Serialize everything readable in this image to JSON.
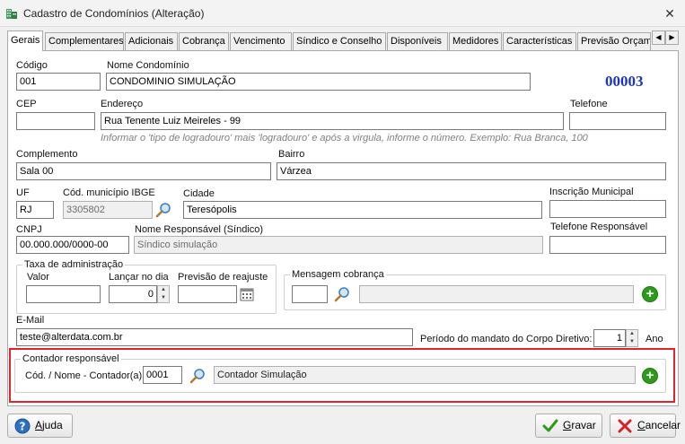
{
  "window": {
    "title": "Cadastro de Condomínios (Alteração)",
    "close": "✕"
  },
  "tabs": [
    {
      "label": "Gerais"
    },
    {
      "label": "Complementares"
    },
    {
      "label": "Adicionais"
    },
    {
      "label": "Cobrança"
    },
    {
      "label": "Vencimento"
    },
    {
      "label": "Síndico e Conselho"
    },
    {
      "label": "Disponíveis"
    },
    {
      "label": "Medidores"
    },
    {
      "label": "Características"
    },
    {
      "label": "Previsão Orçam"
    }
  ],
  "tab_arrows": {
    "left": "◀",
    "right": "▶"
  },
  "form": {
    "codigo": {
      "label": "Código",
      "value": "001"
    },
    "nome": {
      "label": "Nome Condomínio",
      "value": "CONDOMINIO SIMULAÇÃO"
    },
    "code_display": "00003",
    "cep": {
      "label": "CEP",
      "value": ""
    },
    "endereco": {
      "label": "Endereço",
      "value": "Rua Tenente Luiz Meireles - 99"
    },
    "telefone": {
      "label": "Telefone",
      "value": ""
    },
    "hint": "Informar o 'tipo de logradouro' mais 'logradouro' e após a virgula, informe o número. Exemplo: Rua Branca, 100",
    "complemento": {
      "label": "Complemento",
      "value": "Sala 00"
    },
    "bairro": {
      "label": "Bairro",
      "value": "Várzea"
    },
    "uf": {
      "label": "UF",
      "value": "RJ"
    },
    "ibge": {
      "label": "Cód. município IBGE",
      "value": "3305802"
    },
    "cidade": {
      "label": "Cidade",
      "value": "Teresópolis"
    },
    "inscricao": {
      "label": "Inscrição Municipal",
      "value": ""
    },
    "cnpj": {
      "label": "CNPJ",
      "value": "00.000.000/0000-00"
    },
    "responsavel": {
      "label": "Nome Responsável (Síndico)",
      "value": "Síndico simulação"
    },
    "tel_responsavel": {
      "label": "Telefone Responsável",
      "value": ""
    },
    "taxa": {
      "title": "Taxa de administração",
      "valor": {
        "label": "Valor",
        "value": ""
      },
      "lancar": {
        "label": "Lançar no dia",
        "value": "0"
      },
      "previsao": {
        "label": "Previsão de reajuste",
        "value": ""
      }
    },
    "mensagem": {
      "title": "Mensagem cobrança",
      "code": "",
      "text": ""
    },
    "email": {
      "label": "E-Mail",
      "value": "teste@alterdata.com.br"
    },
    "mandato": {
      "label": "Período do mandato do Corpo Diretivo:",
      "value": "1",
      "unit": "Ano"
    },
    "contador": {
      "title": "Contador responsável",
      "label": "Cód. / Nome - Contador(a)",
      "code": "0001",
      "name": "Contador Simulação"
    }
  },
  "buttons": {
    "help": {
      "first": "A",
      "rest": "juda"
    },
    "save": {
      "first": "G",
      "rest": "ravar"
    },
    "cancel": {
      "first": "C",
      "rest": "ancelar"
    }
  },
  "colors": {
    "code_display": "#1a33c0",
    "highlight": "#e0232c",
    "add_green": "#2e9a1c",
    "save_check": "#2e9a1c",
    "cancel_x": "#d8202a"
  },
  "icons": {
    "app": "building-icon",
    "lookup": "magnifier-icon",
    "add": "plus-circle-icon",
    "calendar": "calendar-icon",
    "help": "question-icon",
    "save": "checkmark-icon",
    "cancel": "x-icon"
  }
}
